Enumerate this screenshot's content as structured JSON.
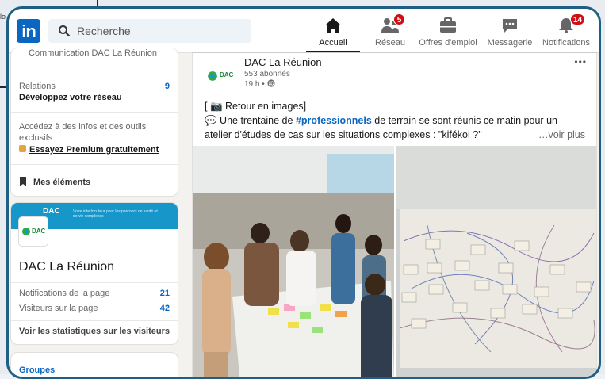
{
  "behind": {
    "top_left_text": "lo"
  },
  "topbar": {
    "logo_text": "in",
    "search_placeholder": "Recherche",
    "nav": [
      {
        "label": "Accueil",
        "icon": "home-icon",
        "active": true
      },
      {
        "label": "Réseau",
        "icon": "people-icon",
        "badge": "5"
      },
      {
        "label": "Offres d'emploi",
        "icon": "briefcase-icon"
      },
      {
        "label": "Messagerie",
        "icon": "message-icon"
      },
      {
        "label": "Notifications",
        "icon": "bell-icon",
        "badge": "14"
      }
    ]
  },
  "left": {
    "cut_text": "Communication DAC La Réunion",
    "relations_label": "Relations",
    "relations_count": "9",
    "relations_sub": "Développez votre réseau",
    "premium_text": "Accédez à des infos et des outils exclusifs",
    "premium_link": "Essayez Premium gratuitement",
    "saved_items": "Mes éléments",
    "page_card": {
      "banner_logo": "DAC",
      "banner_tagline": "Votre interlocuteur pour les parcours de santé et de vie complexes",
      "avatar_text": "DAC",
      "name": "DAC La Réunion",
      "notif_label": "Notifications de la page",
      "notif_count": "21",
      "visitors_label": "Visiteurs sur la page",
      "visitors_count": "42",
      "stats_link": "Voir les statistiques sur les visiteurs"
    },
    "groups_label": "Groupes"
  },
  "post": {
    "author": "DAC La Réunion",
    "avatar_text": "DAC",
    "followers": "553 abonnés",
    "time": "19 h •",
    "menu": "•••",
    "line1": "[ 📷 Retour en images]",
    "line2_pre": "💬 Une trentaine de ",
    "hashtag": "#professionnels",
    "line2_post": " de terrain se sont réunis ce matin pour un",
    "line3": "atelier d'études de cas sur les situations complexes : \"kifékoi ?\"",
    "see_more": "…voir plus"
  },
  "colors": {
    "frame": "#1e5f83",
    "linkedin_blue": "#0a66c2",
    "badge_red": "#cc1016",
    "banner_blue": "#1797c9"
  }
}
